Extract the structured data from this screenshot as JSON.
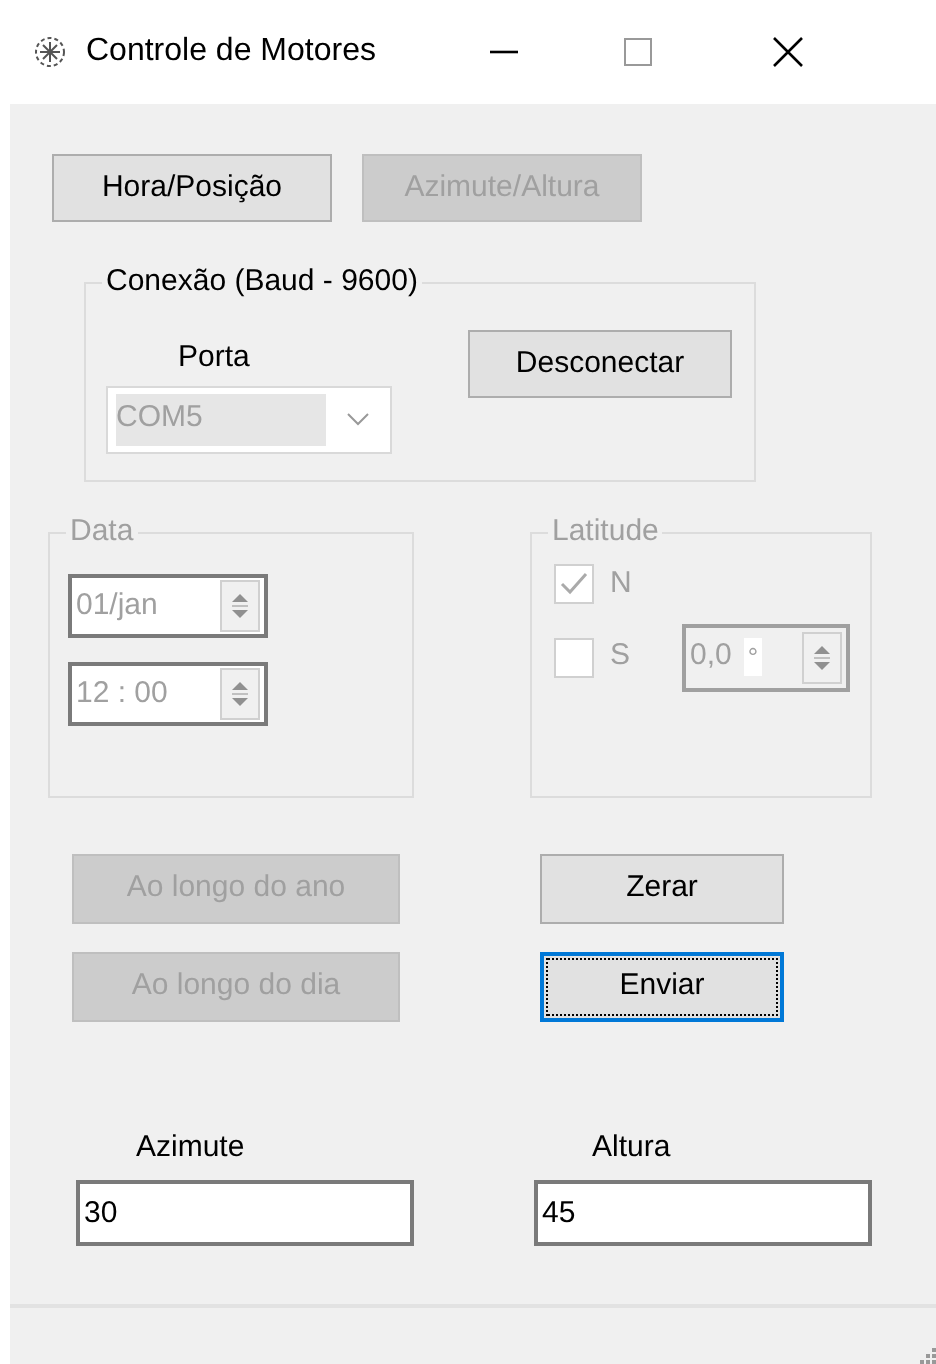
{
  "window": {
    "title": "Controle de Motores"
  },
  "mode_buttons": [
    {
      "label": "Hora/Posição",
      "disabled": false
    },
    {
      "label": "Azimute/Altura",
      "disabled": true
    }
  ],
  "connection": {
    "legend": "Conexão (Baud - 9600)",
    "port_label": "Porta",
    "port_value": "COM5",
    "port_disabled": true,
    "button": "Desconectar"
  },
  "date_group": {
    "legend": "Data",
    "disabled": true,
    "date": "01/jan",
    "time": "12 : 00"
  },
  "latitude_group": {
    "legend": "Latitude",
    "disabled": true,
    "options": [
      {
        "label": "N",
        "checked": true
      },
      {
        "label": "S",
        "checked": false
      }
    ],
    "value": "0,0",
    "unit": "°"
  },
  "action_buttons": [
    {
      "label": "Ao longo do ano",
      "disabled": true,
      "focused": false
    },
    {
      "label": "Zerar",
      "disabled": false,
      "focused": false
    },
    {
      "label": "Ao longo do dia",
      "disabled": true,
      "focused": false
    },
    {
      "label": "Enviar",
      "disabled": false,
      "focused": true
    }
  ],
  "outputs": [
    {
      "label": "Azimute",
      "value": "30"
    },
    {
      "label": "Altura",
      "value": "45"
    }
  ]
}
